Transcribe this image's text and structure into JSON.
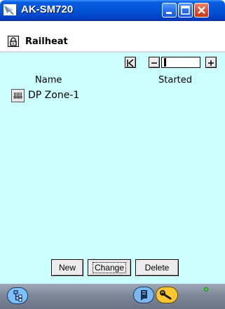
{
  "window": {
    "title": "AK-SM720",
    "minimize_icon": "minimize-icon",
    "maximize_icon": "maximize-icon",
    "close_icon": "close-icon"
  },
  "header": {
    "title": "Railheat",
    "lock_icon": "lock-icon"
  },
  "navigation": {
    "first_icon": "first-page-icon",
    "prev_icon": "previous-icon",
    "next_icon": "next-icon"
  },
  "table": {
    "columns": [
      "Name",
      "Started"
    ],
    "rows": [
      {
        "icon": "heater-icon",
        "name": "DP Zone-1",
        "started": ""
      }
    ]
  },
  "actions": {
    "new_label": "New",
    "change_label": "Change",
    "delete_label": "Delete"
  },
  "bottom_bar": {
    "tree_icon": "tree-view-icon",
    "notes_icon": "notes-icon",
    "wrench_icon": "wrench-icon",
    "status_color": "#3adf3a"
  },
  "colors": {
    "content_background": "#ccffff",
    "titlebar": "#0453d6"
  }
}
